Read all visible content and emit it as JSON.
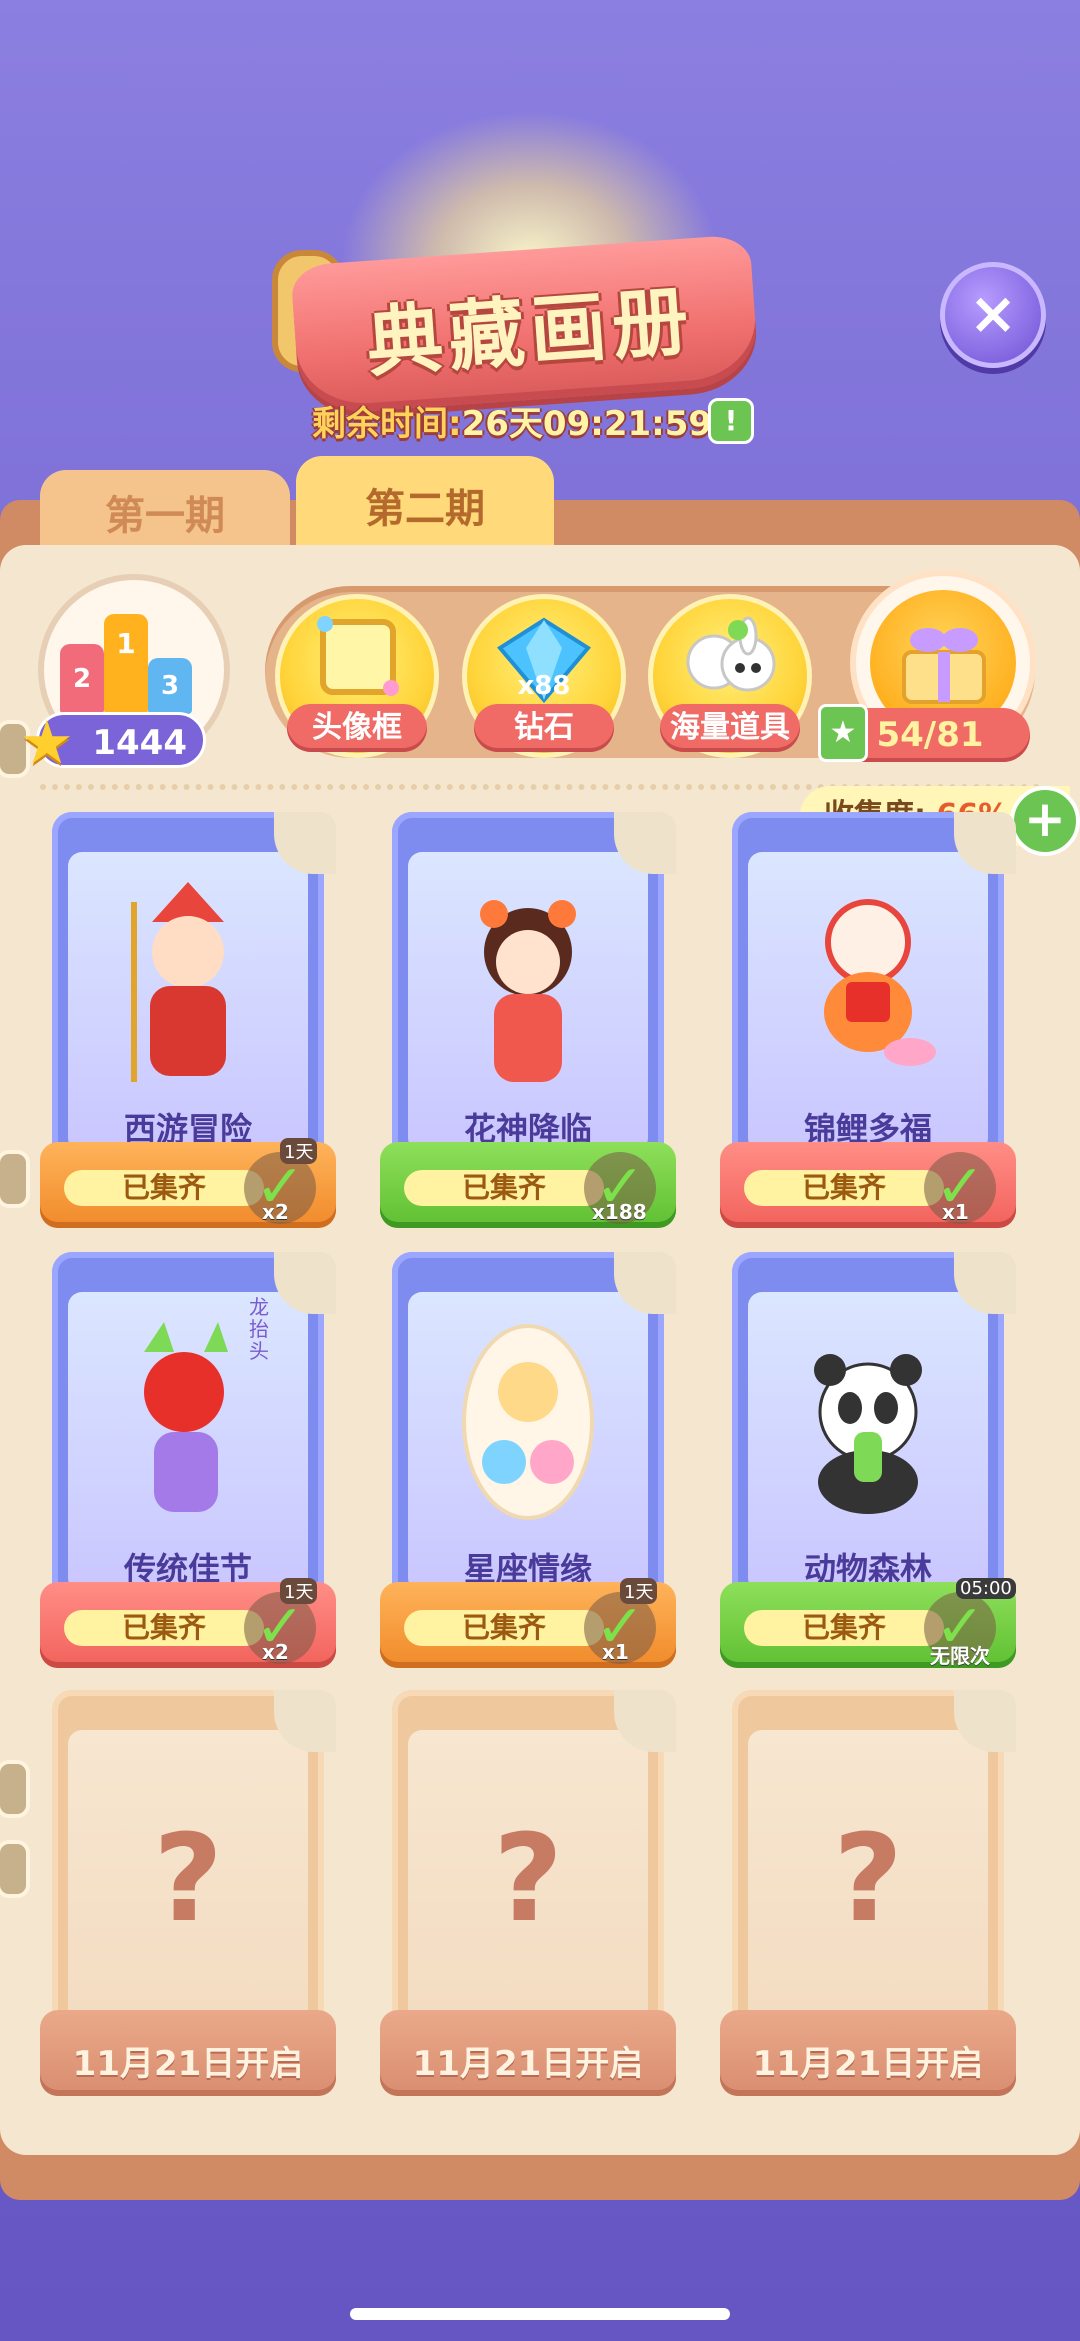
{
  "header": {
    "title": "典藏画册",
    "timer_label": "剩余时间:",
    "timer_value": "26天09:21:59",
    "timer_badge": "!",
    "close_icon": "×"
  },
  "tabs": [
    {
      "label": "第一期",
      "active": false
    },
    {
      "label": "第二期",
      "active": true
    }
  ],
  "stars": {
    "score": "1444",
    "podium": [
      "2",
      "1",
      "3"
    ]
  },
  "rewards": [
    {
      "label": "头像框",
      "icon": "avatar-frame-icon"
    },
    {
      "label": "钻石",
      "icon": "diamond-icon",
      "badge": "x88"
    },
    {
      "label": "海量道具",
      "icon": "props-icon"
    }
  ],
  "gift": {
    "count": "54/81",
    "icon": "gift-box-icon"
  },
  "collection": {
    "label": "收集度:",
    "value": "66%",
    "plus": "+"
  },
  "cards": [
    {
      "name": "西游冒险",
      "status": "已集齐",
      "theme": "orange",
      "tag": "1天",
      "mult": "x2"
    },
    {
      "name": "花神降临",
      "status": "已集齐",
      "theme": "green",
      "tag": "",
      "mult": "x188"
    },
    {
      "name": "锦鲤多福",
      "status": "已集齐",
      "theme": "red",
      "tag": "",
      "mult": "x1"
    },
    {
      "name": "传统佳节",
      "status": "已集齐",
      "theme": "red",
      "tag": "1天",
      "mult": "x2",
      "note": "龙抬头"
    },
    {
      "name": "星座情缘",
      "status": "已集齐",
      "theme": "orange",
      "tag": "1天",
      "mult": "x1"
    },
    {
      "name": "动物森林",
      "status": "已集齐",
      "theme": "green",
      "tag": "05:00",
      "mult": "无限次"
    }
  ],
  "locked_cards": [
    {
      "open_text": "11月21日开启"
    },
    {
      "open_text": "11月21日开启"
    },
    {
      "open_text": "11月21日开启"
    }
  ]
}
